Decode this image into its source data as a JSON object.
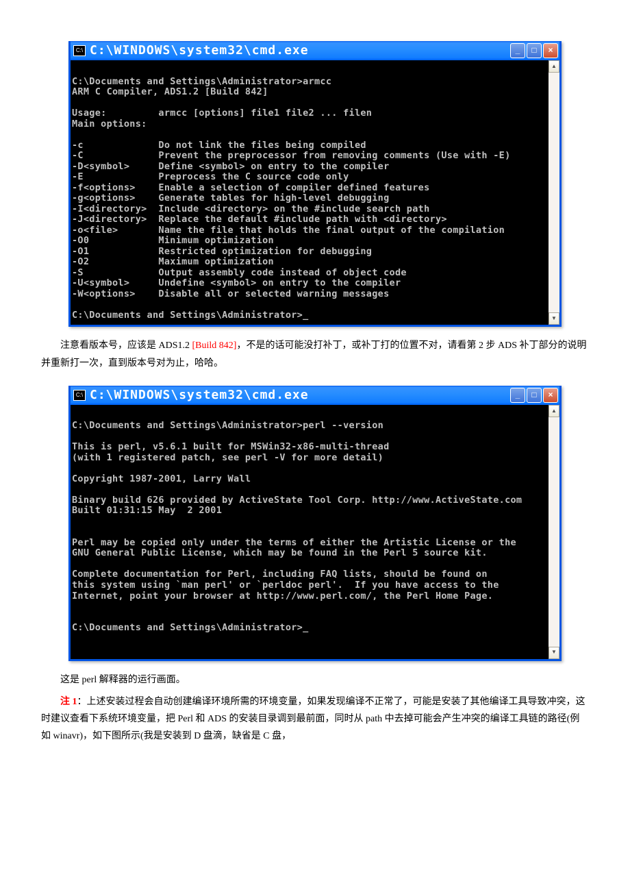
{
  "window1": {
    "title": "C:\\WINDOWS\\system32\\cmd.exe",
    "icon_label": "C:\\",
    "buttons": {
      "min": "_",
      "max": "□",
      "close": "×"
    },
    "content": "\nC:\\Documents and Settings\\Administrator>armcc\nARM C Compiler, ADS1.2 [Build 842]\n\nUsage:         armcc [options] file1 file2 ... filen\nMain options:\n\n-c             Do not link the files being compiled\n-C             Prevent the preprocessor from removing comments (Use with -E)\n-D<symbol>     Define <symbol> on entry to the compiler\n-E             Preprocess the C source code only\n-f<options>    Enable a selection of compiler defined features\n-g<options>    Generate tables for high-level debugging\n-I<directory>  Include <directory> on the #include search path\n-J<directory>  Replace the default #include path with <directory>\n-o<file>       Name the file that holds the final output of the compilation\n-O0            Minimum optimization\n-O1            Restricted optimization for debugging\n-O2            Maximum optimization\n-S             Output assembly code instead of object code\n-U<symbol>     Undefine <symbol> on entry to the compiler\n-W<options>    Disable all or selected warning messages\n\nC:\\Documents and Settings\\Administrator>_"
  },
  "para1": {
    "t1": "注意看版本号，应该是 ADS1.2 ",
    "build": "[Build 842]",
    "t2": "，不是的话可能没打补丁，或补丁打的位置不对，请看第 2 步 ADS 补丁部分的说明并重新打一次，直到版本号对为止，哈哈。"
  },
  "window2": {
    "title": "C:\\WINDOWS\\system32\\cmd.exe",
    "icon_label": "C:\\",
    "buttons": {
      "min": "_",
      "max": "□",
      "close": "×"
    },
    "content": "\nC:\\Documents and Settings\\Administrator>perl --version\n\nThis is perl, v5.6.1 built for MSWin32-x86-multi-thread\n(with 1 registered patch, see perl -V for more detail)\n\nCopyright 1987-2001, Larry Wall\n\nBinary build 626 provided by ActiveState Tool Corp. http://www.ActiveState.com\nBuilt 01:31:15 May  2 2001\n\n\nPerl may be copied only under the terms of either the Artistic License or the\nGNU General Public License, which may be found in the Perl 5 source kit.\n\nComplete documentation for Perl, including FAQ lists, should be found on\nthis system using `man perl' or `perldoc perl'.  If you have access to the\nInternet, point your browser at http://www.perl.com/, the Perl Home Page.\n\n\nC:\\Documents and Settings\\Administrator>_\n\n\n"
  },
  "para2": "这是 perl 解释器的运行画面。",
  "para3": {
    "note": "注 1",
    "t1": "：上述安装过程会自动创建编译环境所需的环境变量，如果发现编译不正常了，可能是安装了其他编译工具导致冲突，这时建议查看下系统环境变量，把 Perl 和 ADS 的安装目录调到最前面，同时从 path 中去掉可能会产生冲突的编译工具链的路径(例如 winavr)，如下图所示(我是安装到 D 盘滴，缺省是 C 盘，"
  }
}
